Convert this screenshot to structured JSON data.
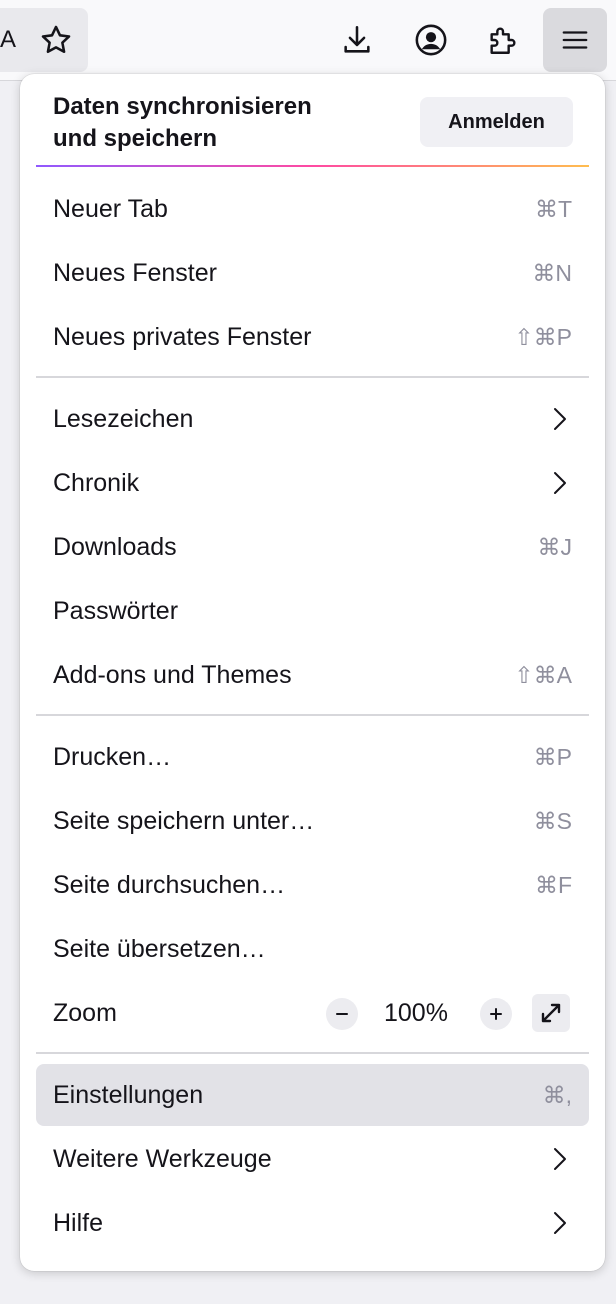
{
  "toolbar": {
    "partial_label": "A",
    "icons": [
      "bookmark-star-icon",
      "download-icon",
      "account-icon",
      "extensions-icon",
      "menu-icon"
    ]
  },
  "sync": {
    "title_line1": "Daten synchronisieren",
    "title_line2": "und speichern",
    "signin_label": "Anmelden"
  },
  "menu": {
    "new_tab": {
      "label": "Neuer Tab",
      "shortcut": "⌘T"
    },
    "new_window": {
      "label": "Neues Fenster",
      "shortcut": "⌘N"
    },
    "new_private_window": {
      "label": "Neues privates Fenster",
      "shortcut": "⇧⌘P"
    },
    "bookmarks": {
      "label": "Lesezeichen"
    },
    "history": {
      "label": "Chronik"
    },
    "downloads": {
      "label": "Downloads",
      "shortcut": "⌘J"
    },
    "passwords": {
      "label": "Passwörter"
    },
    "addons": {
      "label": "Add-ons und Themes",
      "shortcut": "⇧⌘A"
    },
    "print": {
      "label": "Drucken…",
      "shortcut": "⌘P"
    },
    "save_page": {
      "label": "Seite speichern unter…",
      "shortcut": "⌘S"
    },
    "find_in_page": {
      "label": "Seite durchsuchen…",
      "shortcut": "⌘F"
    },
    "translate": {
      "label": "Seite übersetzen…"
    },
    "zoom": {
      "label": "Zoom",
      "value": "100%"
    },
    "settings": {
      "label": "Einstellungen",
      "shortcut": "⌘,"
    },
    "more_tools": {
      "label": "Weitere Werkzeuge"
    },
    "help": {
      "label": "Hilfe"
    }
  },
  "colors": {
    "gradient": [
      "#9059ff",
      "#ff4aa2",
      "#ffbd4f"
    ],
    "active_bg": "#e2e2e7"
  }
}
